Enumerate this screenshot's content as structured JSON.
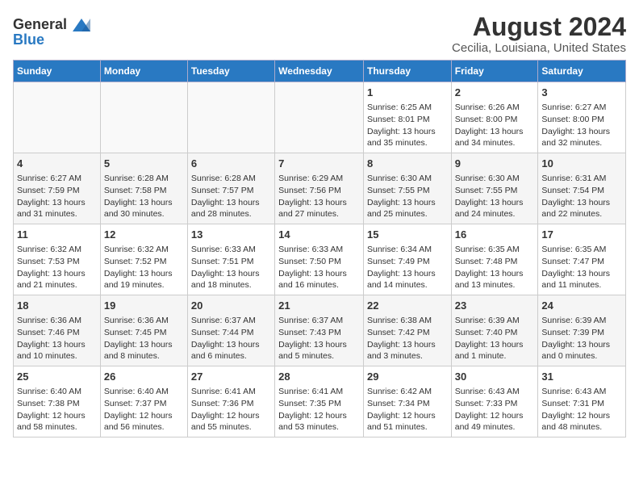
{
  "logo": {
    "general": "General",
    "blue": "Blue"
  },
  "title": "August 2024",
  "subtitle": "Cecilia, Louisiana, United States",
  "days_of_week": [
    "Sunday",
    "Monday",
    "Tuesday",
    "Wednesday",
    "Thursday",
    "Friday",
    "Saturday"
  ],
  "weeks": [
    [
      {
        "day": "",
        "info": ""
      },
      {
        "day": "",
        "info": ""
      },
      {
        "day": "",
        "info": ""
      },
      {
        "day": "",
        "info": ""
      },
      {
        "day": "1",
        "info": "Sunrise: 6:25 AM\nSunset: 8:01 PM\nDaylight: 13 hours and 35 minutes."
      },
      {
        "day": "2",
        "info": "Sunrise: 6:26 AM\nSunset: 8:00 PM\nDaylight: 13 hours and 34 minutes."
      },
      {
        "day": "3",
        "info": "Sunrise: 6:27 AM\nSunset: 8:00 PM\nDaylight: 13 hours and 32 minutes."
      }
    ],
    [
      {
        "day": "4",
        "info": "Sunrise: 6:27 AM\nSunset: 7:59 PM\nDaylight: 13 hours and 31 minutes."
      },
      {
        "day": "5",
        "info": "Sunrise: 6:28 AM\nSunset: 7:58 PM\nDaylight: 13 hours and 30 minutes."
      },
      {
        "day": "6",
        "info": "Sunrise: 6:28 AM\nSunset: 7:57 PM\nDaylight: 13 hours and 28 minutes."
      },
      {
        "day": "7",
        "info": "Sunrise: 6:29 AM\nSunset: 7:56 PM\nDaylight: 13 hours and 27 minutes."
      },
      {
        "day": "8",
        "info": "Sunrise: 6:30 AM\nSunset: 7:55 PM\nDaylight: 13 hours and 25 minutes."
      },
      {
        "day": "9",
        "info": "Sunrise: 6:30 AM\nSunset: 7:55 PM\nDaylight: 13 hours and 24 minutes."
      },
      {
        "day": "10",
        "info": "Sunrise: 6:31 AM\nSunset: 7:54 PM\nDaylight: 13 hours and 22 minutes."
      }
    ],
    [
      {
        "day": "11",
        "info": "Sunrise: 6:32 AM\nSunset: 7:53 PM\nDaylight: 13 hours and 21 minutes."
      },
      {
        "day": "12",
        "info": "Sunrise: 6:32 AM\nSunset: 7:52 PM\nDaylight: 13 hours and 19 minutes."
      },
      {
        "day": "13",
        "info": "Sunrise: 6:33 AM\nSunset: 7:51 PM\nDaylight: 13 hours and 18 minutes."
      },
      {
        "day": "14",
        "info": "Sunrise: 6:33 AM\nSunset: 7:50 PM\nDaylight: 13 hours and 16 minutes."
      },
      {
        "day": "15",
        "info": "Sunrise: 6:34 AM\nSunset: 7:49 PM\nDaylight: 13 hours and 14 minutes."
      },
      {
        "day": "16",
        "info": "Sunrise: 6:35 AM\nSunset: 7:48 PM\nDaylight: 13 hours and 13 minutes."
      },
      {
        "day": "17",
        "info": "Sunrise: 6:35 AM\nSunset: 7:47 PM\nDaylight: 13 hours and 11 minutes."
      }
    ],
    [
      {
        "day": "18",
        "info": "Sunrise: 6:36 AM\nSunset: 7:46 PM\nDaylight: 13 hours and 10 minutes."
      },
      {
        "day": "19",
        "info": "Sunrise: 6:36 AM\nSunset: 7:45 PM\nDaylight: 13 hours and 8 minutes."
      },
      {
        "day": "20",
        "info": "Sunrise: 6:37 AM\nSunset: 7:44 PM\nDaylight: 13 hours and 6 minutes."
      },
      {
        "day": "21",
        "info": "Sunrise: 6:37 AM\nSunset: 7:43 PM\nDaylight: 13 hours and 5 minutes."
      },
      {
        "day": "22",
        "info": "Sunrise: 6:38 AM\nSunset: 7:42 PM\nDaylight: 13 hours and 3 minutes."
      },
      {
        "day": "23",
        "info": "Sunrise: 6:39 AM\nSunset: 7:40 PM\nDaylight: 13 hours and 1 minute."
      },
      {
        "day": "24",
        "info": "Sunrise: 6:39 AM\nSunset: 7:39 PM\nDaylight: 13 hours and 0 minutes."
      }
    ],
    [
      {
        "day": "25",
        "info": "Sunrise: 6:40 AM\nSunset: 7:38 PM\nDaylight: 12 hours and 58 minutes."
      },
      {
        "day": "26",
        "info": "Sunrise: 6:40 AM\nSunset: 7:37 PM\nDaylight: 12 hours and 56 minutes."
      },
      {
        "day": "27",
        "info": "Sunrise: 6:41 AM\nSunset: 7:36 PM\nDaylight: 12 hours and 55 minutes."
      },
      {
        "day": "28",
        "info": "Sunrise: 6:41 AM\nSunset: 7:35 PM\nDaylight: 12 hours and 53 minutes."
      },
      {
        "day": "29",
        "info": "Sunrise: 6:42 AM\nSunset: 7:34 PM\nDaylight: 12 hours and 51 minutes."
      },
      {
        "day": "30",
        "info": "Sunrise: 6:43 AM\nSunset: 7:33 PM\nDaylight: 12 hours and 49 minutes."
      },
      {
        "day": "31",
        "info": "Sunrise: 6:43 AM\nSunset: 7:31 PM\nDaylight: 12 hours and 48 minutes."
      }
    ]
  ]
}
